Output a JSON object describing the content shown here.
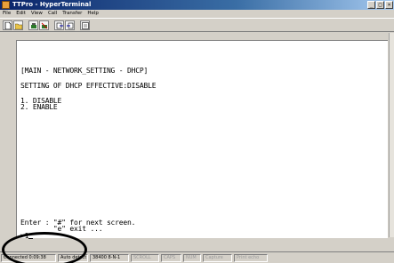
{
  "window": {
    "title": "TTPro - HyperTerminal",
    "controls": {
      "minimize": "_",
      "maximize": "□",
      "close": "×"
    }
  },
  "menu": {
    "items": [
      "File",
      "Edit",
      "View",
      "Call",
      "Transfer",
      "Help"
    ]
  },
  "toolbar": {
    "icons": [
      "new-icon",
      "open-icon",
      "connect-icon",
      "disconnect-icon",
      "send-icon",
      "receive-icon",
      "properties-icon"
    ]
  },
  "terminal": {
    "lines": [
      "[MAIN - NETWORK_SETTING - DHCP]",
      "SETTING OF DHCP EFFECTIVE:DISABLE",
      "1. DISABLE",
      "2. ENABLE",
      "Enter : \"#\" for next screen.",
      "        \"e\" exit ...",
      ">1"
    ]
  },
  "status": {
    "connected": "Connected 0:09:38",
    "detect": "Auto detect",
    "port": "38400 8-N-1",
    "scroll": "SCROLL",
    "caps": "CAPS",
    "num": "NUM",
    "capture": "Capture",
    "print_echo": "Print echo"
  },
  "colors": {
    "titlebar_start": "#0a246a",
    "window_bg": "#d4d0c8",
    "terminal_bg": "#ffffff"
  }
}
